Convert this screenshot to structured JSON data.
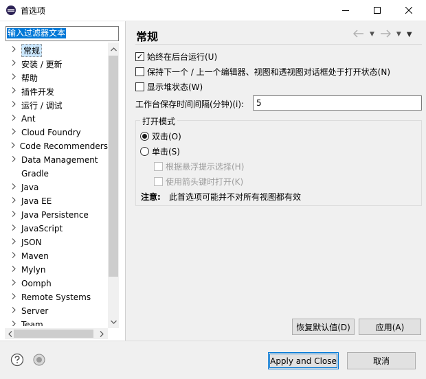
{
  "window": {
    "title": "首选项",
    "controls": [
      "minimize-icon",
      "maximize-icon",
      "close-icon"
    ]
  },
  "filter": {
    "value": "输入过滤器文本"
  },
  "tree": {
    "items": [
      {
        "label": "常规",
        "selected": true
      },
      {
        "label": "安装 / 更新"
      },
      {
        "label": "帮助"
      },
      {
        "label": "插件开发"
      },
      {
        "label": "运行 / 调试"
      },
      {
        "label": "Ant"
      },
      {
        "label": "Cloud Foundry"
      },
      {
        "label": "Code Recommenders"
      },
      {
        "label": "Data Management"
      },
      {
        "label": "Gradle",
        "no_chevron": true
      },
      {
        "label": "Java"
      },
      {
        "label": "Java EE"
      },
      {
        "label": "Java Persistence"
      },
      {
        "label": "JavaScript"
      },
      {
        "label": "JSON"
      },
      {
        "label": "Maven"
      },
      {
        "label": "Mylyn"
      },
      {
        "label": "Oomph"
      },
      {
        "label": "Remote Systems"
      },
      {
        "label": "Server"
      },
      {
        "label": "Team"
      }
    ]
  },
  "page": {
    "heading": "常规",
    "nav_icons": [
      "back-arrow-icon",
      "forward-arrow-icon",
      "view-menu-icon"
    ],
    "checkboxes": [
      {
        "label": "始终在后台运行(U)",
        "checked": true
      },
      {
        "label": "保持下一个 / 上一个编辑器、视图和透视图对话框处于打开状态(N)",
        "checked": false
      },
      {
        "label": "显示堆状态(W)",
        "checked": false
      }
    ],
    "interval": {
      "label": "工作台保存时间间隔(分钟)(i):",
      "value": "5"
    },
    "open_mode": {
      "title": "打开模式",
      "options": [
        {
          "label": "双击(O)",
          "selected": true
        },
        {
          "label": "单击(S)",
          "selected": false
        }
      ],
      "sub_options": [
        {
          "label": "根据悬浮提示选择(H)",
          "checked": false,
          "disabled": true
        },
        {
          "label": "使用箭头键时打开(K)",
          "checked": false,
          "disabled": true
        }
      ],
      "note_label": "注意:",
      "note_text": "此首选项可能并不对所有视图都有效"
    },
    "restore_defaults": "恢复默认值(D)",
    "apply": "应用(A)"
  },
  "footer": {
    "apply_close": "Apply and Close",
    "cancel": "取消",
    "icons": [
      "help-icon",
      "import-export-prefs-icon"
    ]
  },
  "colors": {
    "selection": "#0078d7",
    "tree_selected": "#cce8ff",
    "pane_bg": "#f0f0f0"
  }
}
